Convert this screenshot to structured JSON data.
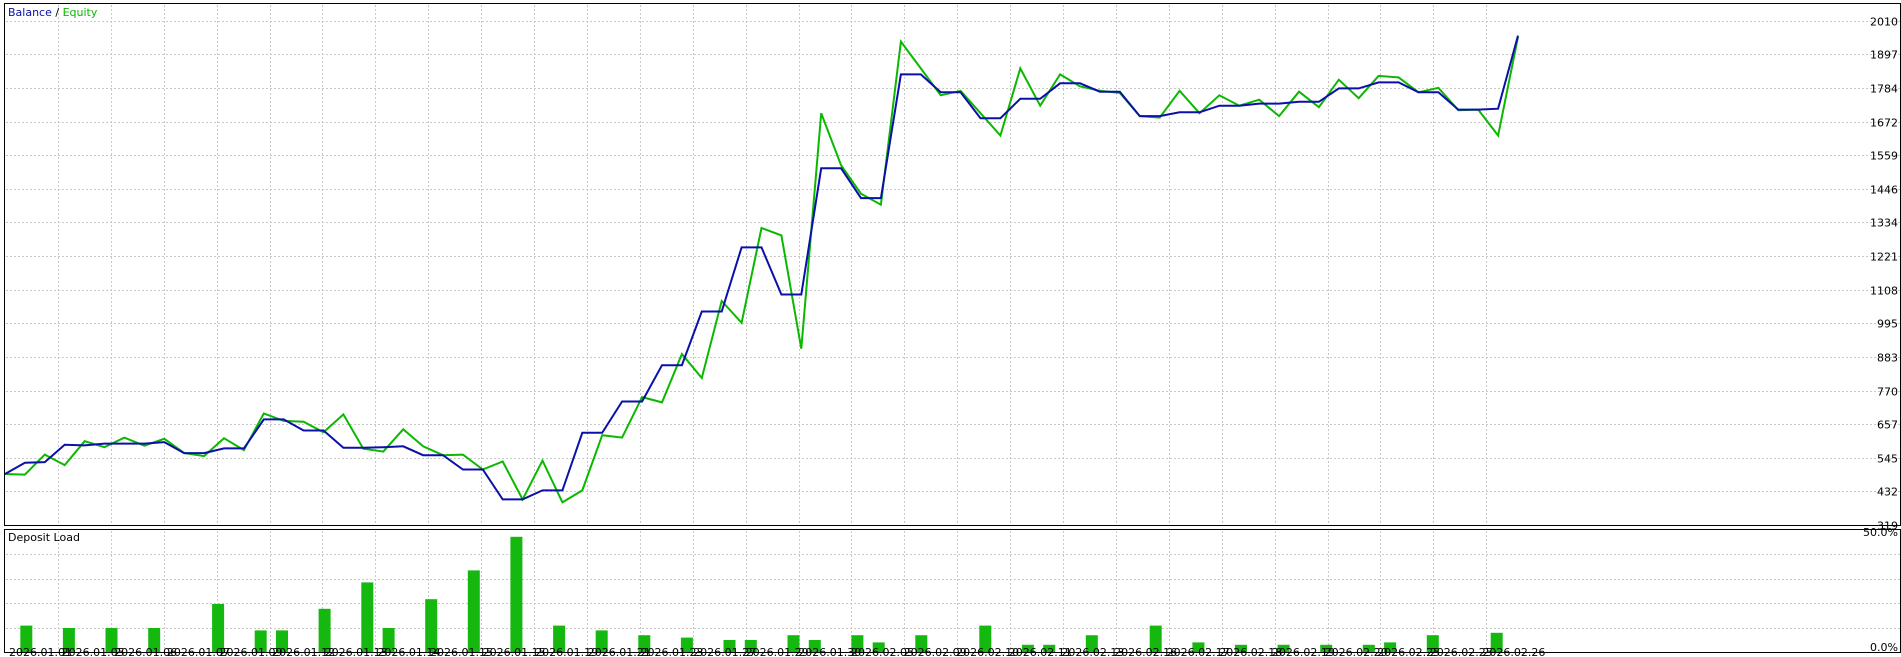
{
  "chart_data": [
    {
      "type": "line",
      "legend": {
        "series_a_label": "Balance",
        "separator": " / ",
        "series_b_label": "Equity",
        "position": "top-left"
      },
      "ylim": [
        319,
        2066
      ],
      "yticks": [
        "319",
        "432",
        "545",
        "657",
        "770",
        "883",
        "995",
        "1108",
        "1221",
        "1334",
        "1446",
        "1559",
        "1672",
        "1784",
        "1897",
        "2010"
      ],
      "grid": true,
      "series": [
        {
          "name": "Balance",
          "color": "#0b10a8",
          "values": [
            [
              0,
              490
            ],
            [
              1,
              528
            ],
            [
              2,
              530
            ],
            [
              3,
              588
            ],
            [
              4,
              586
            ],
            [
              5,
              592
            ],
            [
              6,
              592
            ],
            [
              7,
              592
            ],
            [
              8,
              597
            ],
            [
              9,
              560
            ],
            [
              10,
              560
            ],
            [
              11,
              576
            ],
            [
              12,
              576
            ],
            [
              13,
              673
            ],
            [
              14,
              673
            ],
            [
              15,
              636
            ],
            [
              16,
              636
            ],
            [
              17,
              578
            ],
            [
              18,
              578
            ],
            [
              19,
              580
            ],
            [
              20,
              583
            ],
            [
              21,
              553
            ],
            [
              22,
              553
            ],
            [
              23,
              505
            ],
            [
              24,
              505
            ],
            [
              25,
              405
            ],
            [
              26,
              405
            ],
            [
              27,
              435
            ],
            [
              28,
              435
            ],
            [
              29,
              628
            ],
            [
              30,
              628
            ],
            [
              31,
              733
            ],
            [
              32,
              733
            ],
            [
              33,
              855
            ],
            [
              34,
              855
            ],
            [
              35,
              1035
            ],
            [
              36,
              1035
            ],
            [
              37,
              1250
            ],
            [
              38,
              1250
            ],
            [
              39,
              1092
            ],
            [
              40,
              1092
            ],
            [
              41,
              1515
            ],
            [
              42,
              1515
            ],
            [
              43,
              1415
            ],
            [
              44,
              1415
            ],
            [
              45,
              1830
            ],
            [
              46,
              1830
            ],
            [
              47,
              1770
            ],
            [
              48,
              1770
            ],
            [
              49,
              1683
            ],
            [
              50,
              1683
            ],
            [
              51,
              1748
            ],
            [
              52,
              1748
            ],
            [
              53,
              1800
            ],
            [
              54,
              1800
            ],
            [
              55,
              1772
            ],
            [
              56,
              1772
            ],
            [
              57,
              1690
            ],
            [
              58,
              1690
            ],
            [
              59,
              1703
            ],
            [
              60,
              1703
            ],
            [
              61,
              1725
            ],
            [
              62,
              1725
            ],
            [
              63,
              1732
            ],
            [
              64,
              1732
            ],
            [
              65,
              1738
            ],
            [
              66,
              1738
            ],
            [
              67,
              1783
            ],
            [
              68,
              1783
            ],
            [
              69,
              1803
            ],
            [
              70,
              1803
            ],
            [
              71,
              1770
            ],
            [
              72,
              1770
            ],
            [
              73,
              1712
            ],
            [
              74,
              1712
            ],
            [
              75,
              1715
            ],
            [
              76,
              1960
            ]
          ]
        },
        {
          "name": "Equity",
          "color": "#0ab800",
          "values": [
            [
              0,
              490
            ],
            [
              1,
              488
            ],
            [
              2,
              555
            ],
            [
              3,
              520
            ],
            [
              4,
              600
            ],
            [
              5,
              580
            ],
            [
              6,
              612
            ],
            [
              7,
              585
            ],
            [
              8,
              608
            ],
            [
              9,
              560
            ],
            [
              10,
              550
            ],
            [
              11,
              610
            ],
            [
              12,
              570
            ],
            [
              13,
              693
            ],
            [
              14,
              668
            ],
            [
              15,
              665
            ],
            [
              16,
              630
            ],
            [
              17,
              690
            ],
            [
              18,
              575
            ],
            [
              19,
              565
            ],
            [
              20,
              640
            ],
            [
              21,
              583
            ],
            [
              22,
              553
            ],
            [
              23,
              555
            ],
            [
              24,
              505
            ],
            [
              25,
              532
            ],
            [
              26,
              405
            ],
            [
              27,
              535
            ],
            [
              28,
              395
            ],
            [
              29,
              435
            ],
            [
              30,
              620
            ],
            [
              31,
              612
            ],
            [
              32,
              748
            ],
            [
              33,
              730
            ],
            [
              34,
              892
            ],
            [
              35,
              812
            ],
            [
              36,
              1070
            ],
            [
              37,
              997
            ],
            [
              38,
              1315
            ],
            [
              39,
              1290
            ],
            [
              40,
              910
            ],
            [
              41,
              1700
            ],
            [
              42,
              1525
            ],
            [
              43,
              1430
            ],
            [
              44,
              1393
            ],
            [
              45,
              1940
            ],
            [
              46,
              1850
            ],
            [
              47,
              1760
            ],
            [
              48,
              1775
            ],
            [
              49,
              1700
            ],
            [
              50,
              1625
            ],
            [
              51,
              1850
            ],
            [
              52,
              1725
            ],
            [
              53,
              1830
            ],
            [
              54,
              1790
            ],
            [
              55,
              1775
            ],
            [
              56,
              1768
            ],
            [
              57,
              1690
            ],
            [
              58,
              1685
            ],
            [
              59,
              1775
            ],
            [
              60,
              1700
            ],
            [
              61,
              1760
            ],
            [
              62,
              1725
            ],
            [
              63,
              1745
            ],
            [
              64,
              1690
            ],
            [
              65,
              1772
            ],
            [
              66,
              1720
            ],
            [
              67,
              1812
            ],
            [
              68,
              1750
            ],
            [
              69,
              1825
            ],
            [
              70,
              1820
            ],
            [
              71,
              1770
            ],
            [
              72,
              1785
            ],
            [
              73,
              1710
            ],
            [
              74,
              1712
            ],
            [
              75,
              1625
            ],
            [
              76,
              1955
            ]
          ]
        }
      ]
    },
    {
      "type": "bar",
      "title": "Deposit Load",
      "ylim": [
        0,
        50
      ],
      "yticks": [
        "0.0%",
        "50.0%"
      ],
      "grid": true,
      "bar_color": "#14b80f",
      "x_categories": [
        "2026.01.01",
        "2026.01.05",
        "2026.01.06",
        "2026.01.07",
        "2026.01.09",
        "2026.01.12",
        "2026.01.13",
        "2026.01.14",
        "2026.01.15",
        "2026.01.15",
        "2026.01.19",
        "2026.01.21",
        "2026.01.23",
        "2026.01.27",
        "2026.01.29",
        "2026.01.30",
        "2026.02.05",
        "2026.02.09",
        "2026.02.10",
        "2026.02.11",
        "2026.02.13",
        "2026.02.16",
        "2026.02.17",
        "2026.02.18",
        "2026.02.19",
        "2026.02.20",
        "2026.02.25",
        "2026.02.25",
        "2026.02.26"
      ],
      "values": [
        [
          1,
          11
        ],
        [
          3,
          10
        ],
        [
          5,
          10
        ],
        [
          7,
          10
        ],
        [
          10,
          20
        ],
        [
          12,
          9
        ],
        [
          13,
          9
        ],
        [
          15,
          18
        ],
        [
          17,
          29
        ],
        [
          18,
          10
        ],
        [
          20,
          22
        ],
        [
          22,
          34
        ],
        [
          24,
          48
        ],
        [
          26,
          11
        ],
        [
          28,
          9
        ],
        [
          30,
          7
        ],
        [
          32,
          6
        ],
        [
          34,
          5
        ],
        [
          35,
          5
        ],
        [
          37,
          7
        ],
        [
          38,
          5
        ],
        [
          40,
          7
        ],
        [
          41,
          4
        ],
        [
          43,
          7
        ],
        [
          46,
          11
        ],
        [
          48,
          3
        ],
        [
          49,
          3
        ],
        [
          51,
          7
        ],
        [
          54,
          11
        ],
        [
          56,
          4
        ],
        [
          58,
          3
        ],
        [
          60,
          3
        ],
        [
          62,
          3
        ],
        [
          64,
          3
        ],
        [
          65,
          4
        ],
        [
          67,
          7
        ],
        [
          70,
          8
        ]
      ],
      "x_range": [
        0,
        71
      ]
    }
  ]
}
